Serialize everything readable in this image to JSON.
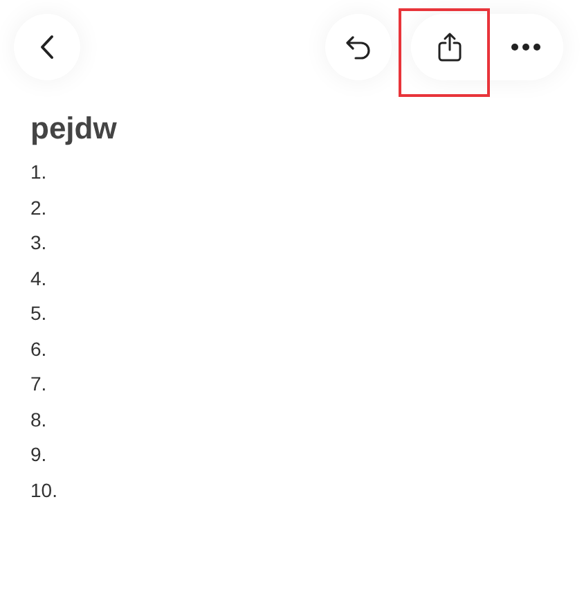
{
  "toolbar": [
    {
      "kind": "back",
      "highlighted": false
    },
    {
      "kind": "undo",
      "highlighted": false
    },
    {
      "kind": "share",
      "highlighted": true
    },
    {
      "kind": "more",
      "highlighted": false
    }
  ],
  "title": "pejdw",
  "list": [
    "1.",
    "2.",
    "3.",
    "4.",
    "5.",
    "6.",
    "7.",
    "8.",
    "9.",
    "10."
  ]
}
